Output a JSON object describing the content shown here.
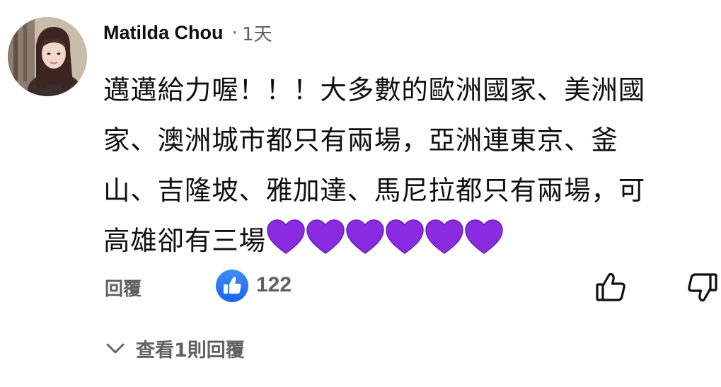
{
  "comment": {
    "author": "Matilda Chou",
    "separator": "·",
    "time": "1天",
    "text_lines": [
      "邁邁給力喔！！！大多數的歐洲國家、美洲國",
      "家、澳洲城市都只有兩場，亞洲連東京、釜",
      "山、吉隆坡、雅加達、馬尼拉都只有兩場，可",
      "高雄卻有三場"
    ],
    "hearts": [
      "purple-heart",
      "purple-heart",
      "purple-heart",
      "purple-heart",
      "purple-heart",
      "purple-heart"
    ],
    "reply_label": "回覆",
    "like_count": "122",
    "view_replies_label": "查看1則回覆"
  },
  "colors": {
    "like_badge": "#1a66e8",
    "heart": "#8a2be2",
    "secondary_text": "#606060"
  },
  "icons": {
    "like_badge": "blue-thumbs-up-icon",
    "like": "thumbs-up-icon",
    "dislike": "thumbs-down-icon",
    "expand": "chevron-down-icon"
  }
}
